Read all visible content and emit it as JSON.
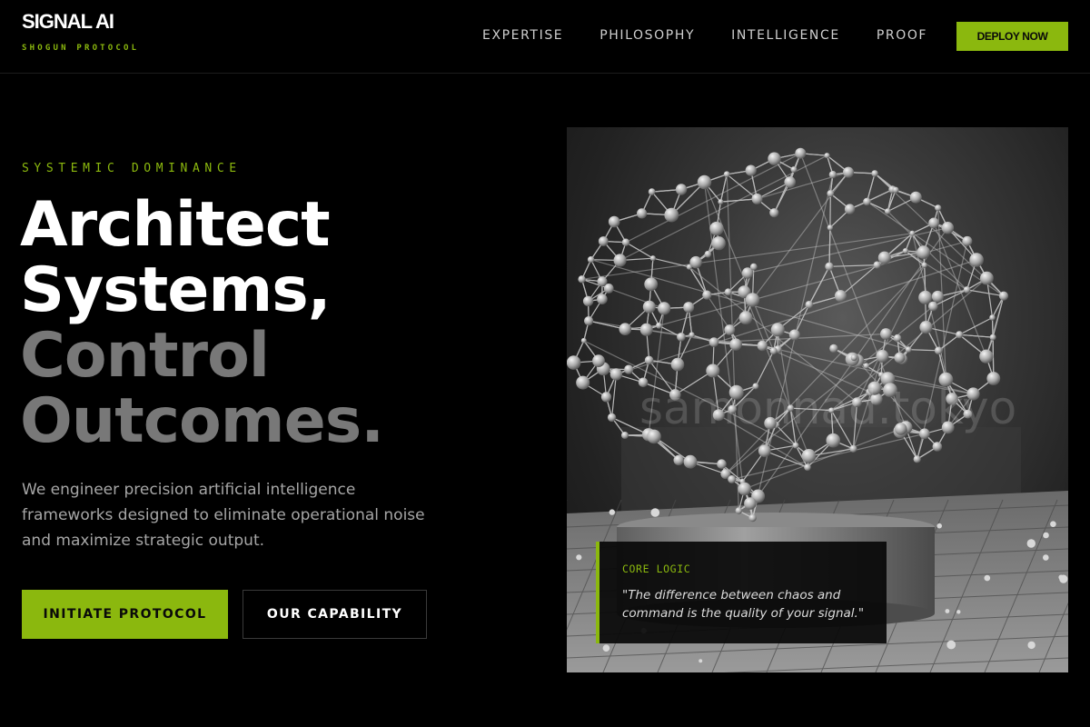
{
  "brand": {
    "name": "SIGNAL AI",
    "tagline": "SHOGUN PROTOCOL"
  },
  "nav": {
    "items": [
      {
        "label": "EXPERTISE"
      },
      {
        "label": "PHILOSOPHY"
      },
      {
        "label": "INTELLIGENCE"
      },
      {
        "label": "PROOF"
      }
    ],
    "cta_label": "DEPLOY NOW"
  },
  "hero": {
    "eyebrow": "SYSTEMIC DOMINANCE",
    "headline": {
      "line1": "Architect",
      "line2": "Systems,",
      "line3": "Control",
      "line4": "Outcomes."
    },
    "description": "We engineer precision artificial intelligence frameworks designed to eliminate operational noise and maximize strategic output.",
    "primary_button": "INITIATE PROTOCOL",
    "secondary_button": "OUR CAPABILITY"
  },
  "image": {
    "watermark": "samonnad.tokyo",
    "subject_icon": "neural-network-brain-sculpture"
  },
  "quote_card": {
    "label": "CORE LOGIC",
    "quote": "\"The difference between chaos and command is the quality of your signal.\""
  },
  "colors": {
    "accent": "#8bb80e",
    "background": "#000000",
    "headline_white": "#ffffff",
    "headline_gray": "#787878",
    "body_text": "#a6a6a6"
  }
}
